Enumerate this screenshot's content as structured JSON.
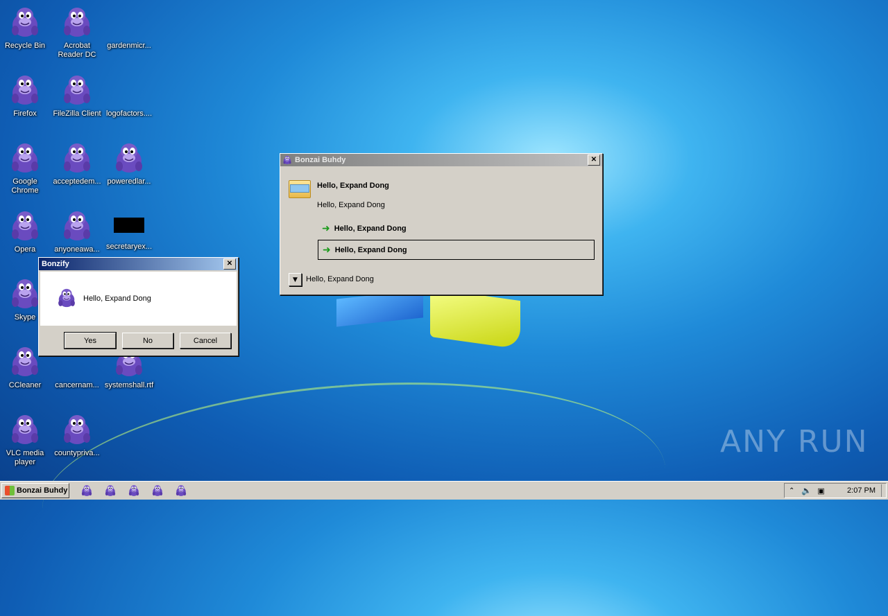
{
  "desktop": {
    "icons": [
      {
        "label": "Recycle Bin"
      },
      {
        "label": "Acrobat\nReader DC"
      },
      {
        "label": "gardenmicr..."
      },
      {
        "label": "Firefox"
      },
      {
        "label": "FileZilla Client"
      },
      {
        "label": "logofactors...."
      },
      {
        "label": "Google\nChrome"
      },
      {
        "label": "acceptedem..."
      },
      {
        "label": "poweredlar..."
      },
      {
        "label": "Opera"
      },
      {
        "label": "anyoneawa..."
      },
      {
        "label": "secretaryex..."
      },
      {
        "label": "Skype"
      },
      {
        "label": "CCleaner"
      },
      {
        "label": "cancernam..."
      },
      {
        "label": "systemshall.rtf"
      },
      {
        "label": "VLC media\nplayer"
      },
      {
        "label": "countypriva..."
      }
    ],
    "watermark": "ANY RUN"
  },
  "bonzi_dialog": {
    "title": "Bonzai Buhdy",
    "heading": "Hello, Expand Dong",
    "subtext": "Hello, Expand Dong",
    "options": [
      "Hello, Expand Dong",
      "Hello, Expand Dong"
    ],
    "footer": "Hello, Expand Dong"
  },
  "bonzify_dialog": {
    "title": "Bonzify",
    "message": "Hello, Expand Dong",
    "buttons": {
      "yes": "Yes",
      "no": "No",
      "cancel": "Cancel"
    }
  },
  "taskbar": {
    "start_label": "Bonzai Buhdy",
    "clock": "2:07 PM"
  },
  "colors": {
    "title_active": "#0a246a",
    "window_face": "#d4d0c8",
    "bonzi_purple": "#7a5cc8"
  }
}
